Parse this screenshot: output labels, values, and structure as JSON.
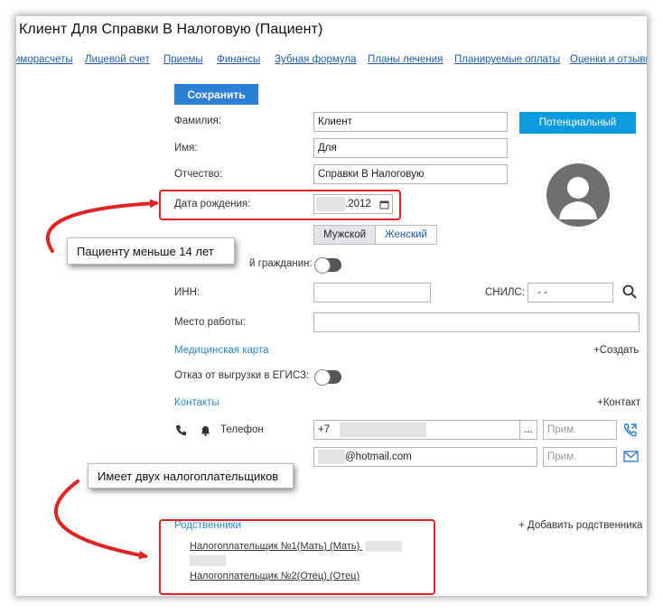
{
  "window": {
    "title": "Клиент Для Справки В Налоговую (Пациент)"
  },
  "tabs": [
    "иморасчеты",
    "Лицевой счет",
    "Приемы",
    "Финансы",
    "Зубная формула",
    "Планы лечения",
    "Планируемые оплаты",
    "Оценки и отзывы"
  ],
  "toolbar": {
    "save_label": "Сохранить",
    "status_label": "Потенциальный"
  },
  "form": {
    "last_name_label": "Фамилия:",
    "last_name_value": "Клиент",
    "first_name_label": "Имя:",
    "first_name_value": "Для",
    "patronymic_label": "Отчество:",
    "patronymic_value": "Справки В Налоговую",
    "birthdate_label": "Дата рождения:",
    "birthdate_value": ".2012",
    "gender_male": "Мужской",
    "gender_female": "Женский",
    "citizen_label": "й гражданин:",
    "inn_label": "ИНН:",
    "snils_label": "СНИЛС:",
    "snils_value": "-   -",
    "workplace_label": "Место работы:",
    "medcard_label": "Медицинская карта",
    "medcard_create": "+Создать",
    "egisz_label": "Отказ от выгрузки в ЕГИСЗ:"
  },
  "contacts": {
    "title": "Контакты",
    "add_label": "+Контакт",
    "phone_label": "Телефон",
    "phone_value": "+7",
    "more_button": "...",
    "note_placeholder": "Прим.",
    "email_value": "@hotmail.com"
  },
  "relatives": {
    "title": "Родственники",
    "add_label": "+ Добавить родственника",
    "items": [
      "Налогоплательщик №1(Мать)  (Мать)",
      "Налогоплательщик №2(Отец)  (Отец)"
    ]
  },
  "annotations": {
    "callout_age": "Пациенту меньше 14 лет",
    "callout_payers": "Имеет двух налогоплательщиков"
  },
  "colors": {
    "accent": "#2b7fd4",
    "status": "#0f9be0",
    "annotation": "#e02424",
    "link": "#1f5fa8"
  }
}
